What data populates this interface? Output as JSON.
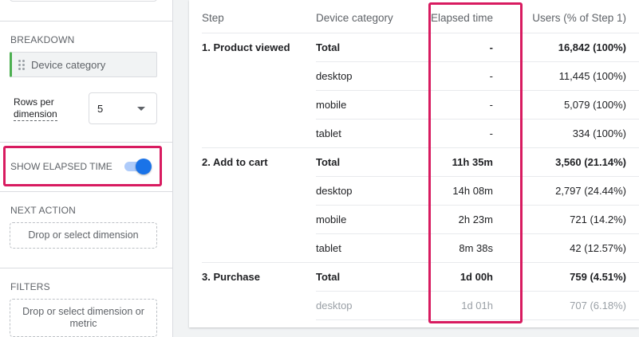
{
  "panel": {
    "breakdown_label": "BREAKDOWN",
    "breakdown_chip": "Device category",
    "rows_per_dimension_label_1": "Rows per",
    "rows_per_dimension_label_2": "dimension",
    "rows_per_dimension_value": "5",
    "show_elapsed_time_label": "SHOW ELAPSED TIME",
    "show_elapsed_time_on": true,
    "next_action_label": "NEXT ACTION",
    "next_action_placeholder": "Drop or select dimension",
    "filters_label": "FILTERS",
    "filters_placeholder_1": "Drop or select dimension or",
    "filters_placeholder_2": "metric"
  },
  "table": {
    "headers": {
      "step": "Step",
      "device": "Device category",
      "elapsed": "Elapsed time",
      "users": "Users (% of Step 1)"
    },
    "rows": [
      {
        "step": "1. Product viewed",
        "device": "Total",
        "elapsed": "-",
        "users": "16,842 (100%)"
      },
      {
        "step": "",
        "device": "desktop",
        "elapsed": "-",
        "users": "11,445 (100%)"
      },
      {
        "step": "",
        "device": "mobile",
        "elapsed": "-",
        "users": "5,079 (100%)"
      },
      {
        "step": "",
        "device": "tablet",
        "elapsed": "-",
        "users": "334 (100%)"
      },
      {
        "step": "2. Add to cart",
        "device": "Total",
        "elapsed": "11h 35m",
        "users": "3,560 (21.14%)"
      },
      {
        "step": "",
        "device": "desktop",
        "elapsed": "14h 08m",
        "users": "2,797 (24.44%)"
      },
      {
        "step": "",
        "device": "mobile",
        "elapsed": "2h 23m",
        "users": "721 (14.2%)"
      },
      {
        "step": "",
        "device": "tablet",
        "elapsed": "8m 38s",
        "users": "42 (12.57%)"
      },
      {
        "step": "3. Purchase",
        "device": "Total",
        "elapsed": "1d 00h",
        "users": "759 (4.51%)"
      },
      {
        "step": "",
        "device": "desktop",
        "elapsed": "1d 01h",
        "users": "707 (6.18%)"
      }
    ]
  },
  "colors": {
    "highlight": "#d81b60",
    "toggle_on": "#1a73e8",
    "chip_accent": "#4caf50"
  }
}
